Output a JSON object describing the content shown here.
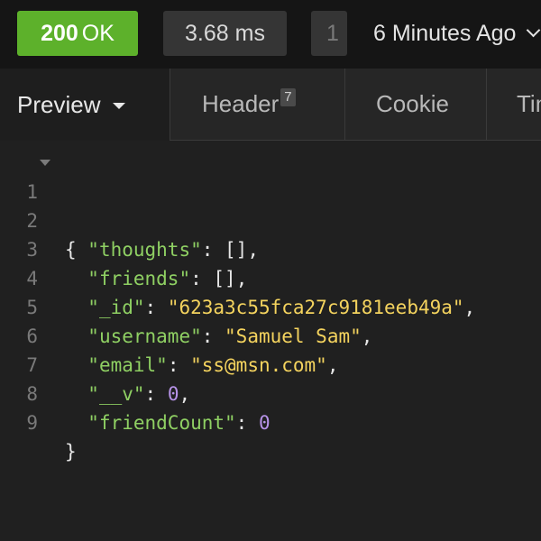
{
  "response": {
    "status_code": "200",
    "status_text": "OK",
    "time": "3.68 ms",
    "size_partial": "1",
    "history": "6 Minutes Ago"
  },
  "tabs": {
    "preview": "Preview",
    "header": "Header",
    "header_count": "7",
    "cookie": "Cookie",
    "timeline_partial": "Tim"
  },
  "code": {
    "line_numbers": [
      "1",
      "2",
      "3",
      "4",
      "5",
      "6",
      "7",
      "8",
      "9"
    ],
    "open_brace": "{",
    "close_brace": "}",
    "fields": [
      {
        "key": "\"thoughts\"",
        "value": "[]",
        "value_type": "punc",
        "comma": ","
      },
      {
        "key": "\"friends\"",
        "value": "[]",
        "value_type": "punc",
        "comma": ","
      },
      {
        "key": "\"_id\"",
        "value": "\"623a3c55fca27c9181eeb49a\"",
        "value_type": "string",
        "comma": ","
      },
      {
        "key": "\"username\"",
        "value": "\"Samuel Sam\"",
        "value_type": "string",
        "comma": ","
      },
      {
        "key": "\"email\"",
        "value": "\"ss@msn.com\"",
        "value_type": "string",
        "comma": ","
      },
      {
        "key": "\"__v\"",
        "value": "0",
        "value_type": "number",
        "comma": ","
      },
      {
        "key": "\"friendCount\"",
        "value": "0",
        "value_type": "number",
        "comma": ""
      }
    ]
  },
  "colors": {
    "status_ok": "#5db12b",
    "json_key": "#8fd063",
    "json_string": "#f4d35e",
    "json_number": "#b793e8"
  }
}
